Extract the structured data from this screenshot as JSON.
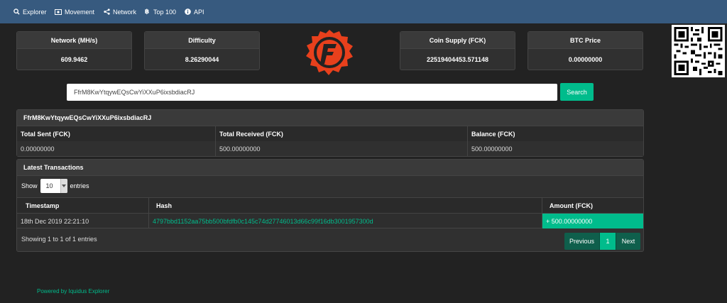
{
  "nav": {
    "items": [
      {
        "label": "Explorer",
        "icon": "search-icon"
      },
      {
        "label": "Movement",
        "icon": "money-icon"
      },
      {
        "label": "Network",
        "icon": "share-icon"
      },
      {
        "label": "Top 100",
        "icon": "bitcoin-icon"
      },
      {
        "label": "API",
        "icon": "info-icon"
      }
    ]
  },
  "stats": {
    "network": {
      "label": "Network (MH/s)",
      "value": "609.9462"
    },
    "difficulty": {
      "label": "Difficulty",
      "value": "8.26290044"
    },
    "supply": {
      "label": "Coin Supply (FCK)",
      "value": "22519404453.571148"
    },
    "btc": {
      "label": "BTC Price",
      "value": "0.00000000"
    }
  },
  "search": {
    "value": "FfrM8KwYtqywEQsCwYiXXuP6ixsbdiacRJ",
    "button_label": "Search"
  },
  "address": {
    "title": "FfrM8KwYtqywEQsCwYiXXuP6ixsbdiacRJ",
    "headers": [
      "Total Sent (FCK)",
      "Total Received (FCK)",
      "Balance (FCK)"
    ],
    "values": [
      "0.00000000",
      "500.00000000",
      "500.00000000"
    ]
  },
  "transactions": {
    "title": "Latest Transactions",
    "show_label": "Show",
    "page_size": "10",
    "entries_label": "entries",
    "headers": [
      "Timestamp",
      "Hash",
      "Amount (FCK)"
    ],
    "rows": [
      {
        "timestamp": "18th Dec 2019 22:21:10",
        "hash": "4797bbd1152aa75bb500bfdfb0c145c74d27746013d66c99f16db3001957300d",
        "amount": "+ 500.00000000"
      }
    ],
    "info": "Showing 1 to 1 of 1 entries",
    "pager": {
      "prev": "Previous",
      "current": "1",
      "next": "Next"
    }
  },
  "footer": {
    "text": "Powered by Iquidus Explorer"
  },
  "colors": {
    "accent": "#00bc8c",
    "navbar": "#375a7f",
    "background": "#222222"
  }
}
